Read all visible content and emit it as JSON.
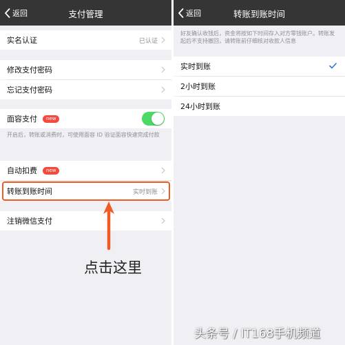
{
  "left": {
    "nav": {
      "back_label": "返回",
      "title": "支付管理"
    },
    "rows": {
      "real_name": {
        "label": "实名认证",
        "value": "已认证"
      },
      "change_password": {
        "label": "修改支付密码"
      },
      "forgot_password": {
        "label": "忘记支付密码"
      },
      "face_pay": {
        "label": "面容支付",
        "badge": "new",
        "toggle_on": true
      },
      "face_pay_note": "开启后，转账或消费时，可使用面容 ID 验证面容快速完成付款",
      "auto_debit": {
        "label": "自动扣费",
        "badge": "new"
      },
      "transfer_time": {
        "label": "转账到账时间",
        "value": "实时到账"
      },
      "cancel_wechat_pay": {
        "label": "注销微信支付"
      }
    },
    "annotation": {
      "text": "点击这里",
      "color": "#f05a24"
    }
  },
  "right": {
    "nav": {
      "back_label": "返回",
      "title": "转账到账时间"
    },
    "note": "好友确认收钱后，资金将按如下时间存入对方零钱账户。转账发起后不支持撤回，请转账前仔细核对收款人信息",
    "options": [
      {
        "label": "实时到账",
        "selected": true
      },
      {
        "label": "2小时到账",
        "selected": false
      },
      {
        "label": "24小时到账",
        "selected": false
      }
    ]
  },
  "watermark": "头条号 / IT168手机频道",
  "colors": {
    "nav_bg": "#353536",
    "page_bg": "#efeff4",
    "toggle_on": "#4cd964",
    "badge": "#f44a3e",
    "check": "#2e75d6",
    "highlight": "#f05a24"
  }
}
